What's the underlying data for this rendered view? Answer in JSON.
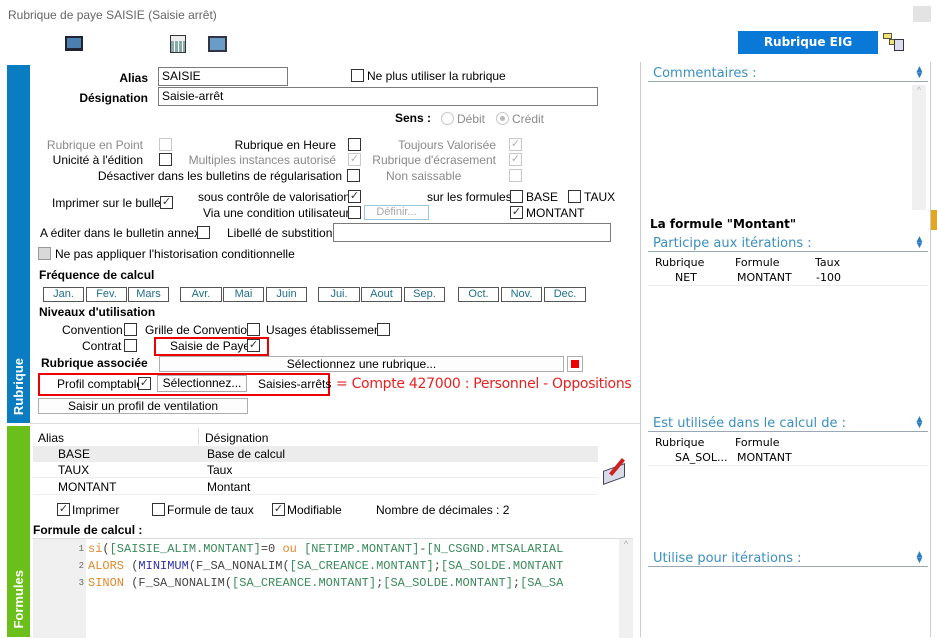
{
  "window": {
    "title": "Rubrique de paye SAISIE (Saisie arrêt)"
  },
  "toolbar": {
    "icons": [
      "monitor-icon",
      "calculator-icon",
      "window-monitor-icon"
    ],
    "eig_button": "Rubrique EIG"
  },
  "sidebar": {
    "rubrique": "Rubrique",
    "formules": "Formules",
    "rubrique_color": "#0a7cc1",
    "formules_color": "#6abf1a"
  },
  "form": {
    "alias_label": "Alias",
    "alias_value": "SAISIE",
    "designation_label": "Désignation",
    "designation_value": "Saisie-arrêt",
    "ne_plus_utiliser": {
      "label": "Ne plus utiliser la rubrique",
      "checked": false
    },
    "sens": {
      "label": "Sens :",
      "options": [
        "Débit",
        "Crédit"
      ],
      "selected": "Crédit"
    },
    "rubrique_en_point": {
      "label": "Rubrique en Point",
      "checked": false
    },
    "rubrique_en_heure": {
      "label": "Rubrique en Heure",
      "checked": false
    },
    "toujours_valorisee": {
      "label": "Toujours Valorisée",
      "checked": true
    },
    "unicite": {
      "label": "Unicité à l'édition",
      "checked": false
    },
    "multiples": {
      "label": "Multiples instances autorisé",
      "checked": true
    },
    "ecrasement": {
      "label": "Rubrique d'écrasement",
      "checked": true
    },
    "desactiver": {
      "label": "Désactiver dans les bulletins de régularisation",
      "checked": false
    },
    "non_saissable": {
      "label": "Non saissable",
      "checked": false
    },
    "imprimer_bulletin": {
      "label": "Imprimer sur le bulletin",
      "checked": true
    },
    "sous_controle": {
      "label": "sous contrôle de valorisation",
      "checked": true
    },
    "via_condition": {
      "label": "Via une condition utilisateur",
      "checked": false
    },
    "definir": "Définir...",
    "sur_formules": {
      "label": "sur les formules :",
      "base": "BASE",
      "base_checked": false,
      "taux": "TAUX",
      "taux_checked": false,
      "montant": "MONTANT",
      "montant_checked": true
    },
    "bulletin_annexe": {
      "label": "A éditer dans le bulletin annexe",
      "checked": false
    },
    "libelle_substition": {
      "label": "Libellé de substition :",
      "value": ""
    },
    "historisation": {
      "label": "Ne pas appliquer l'historisation conditionnelle",
      "checked": false
    },
    "frequence": {
      "label": "Fréquence de calcul",
      "months": [
        "Jan.",
        "Fev.",
        "Mars",
        "Avr.",
        "Mai",
        "Juin",
        "Jui.",
        "Aout",
        "Sep.",
        "Oct.",
        "Nov.",
        "Dec."
      ]
    },
    "niveaux": {
      "label": "Niveaux d'utilisation",
      "convention": "Convention",
      "grille": "Grille de Convention",
      "usages": "Usages établissement",
      "contrat": "Contrat",
      "saisie_paye": "Saisie de Paye",
      "saisie_paye_checked": true
    },
    "rubrique_associee": {
      "label": "Rubrique associée",
      "button": "Sélectionnez une rubrique..."
    },
    "profil_comptable": {
      "label": "Profil comptable",
      "checked": true,
      "button": "Sélectionnez...",
      "value": "Saisies-arrêts"
    },
    "annotation": "= Compte 427000 : Personnel - Oppositions",
    "ventilation_button": "Saisir un profil de ventilation"
  },
  "formules": {
    "columns": [
      "Alias",
      "Désignation"
    ],
    "rows": [
      {
        "alias": "BASE",
        "designation": "Base de calcul"
      },
      {
        "alias": "TAUX",
        "designation": "Taux"
      },
      {
        "alias": "MONTANT",
        "designation": "Montant"
      }
    ],
    "imprimer": {
      "label": "Imprimer",
      "checked": true
    },
    "formule_taux": {
      "label": "Formule de taux",
      "checked": false
    },
    "modifiable": {
      "label": "Modifiable",
      "checked": true
    },
    "decimales": "Nombre de décimales : 2",
    "formule_label": "Formule de calcul :",
    "code": [
      {
        "n": "1",
        "tokens": [
          [
            "kw",
            "si"
          ],
          [
            "df",
            "("
          ],
          [
            "fd",
            "[SAISIE_ALIM.MONTANT]"
          ],
          [
            "df",
            "=0 "
          ],
          [
            "kw",
            "ou"
          ],
          [
            "df",
            " "
          ],
          [
            "fd",
            "[NETIMP.MONTANT]"
          ],
          [
            "df",
            "-"
          ],
          [
            "fd",
            "[N_CSGND.MTSALARIAL"
          ]
        ]
      },
      {
        "n": "2",
        "tokens": [
          [
            "kw",
            "ALORS"
          ],
          [
            "df",
            " ("
          ],
          [
            "fn",
            "MINIMUM"
          ],
          [
            "df",
            "(F_SA_NONALIM("
          ],
          [
            "fd",
            "[SA_CREANCE.MONTANT]"
          ],
          [
            "df",
            ";"
          ],
          [
            "fd",
            "[SA_SOLDE.MONTANT"
          ]
        ]
      },
      {
        "n": "3",
        "tokens": [
          [
            "kw",
            "SINON"
          ],
          [
            "df",
            " (F_SA_NONALIM("
          ],
          [
            "fd",
            "[SA_CREANCE.MONTANT]"
          ],
          [
            "df",
            ";"
          ],
          [
            "fd",
            "[SA_SOLDE.MONTANT]"
          ],
          [
            "df",
            ";"
          ],
          [
            "fd",
            "[SA_SA"
          ]
        ]
      }
    ]
  },
  "right": {
    "commentaires": "Commentaires :",
    "formule_title": "La formule \"Montant\"",
    "participe": "Participe aux itérations :",
    "participe_cols": [
      "Rubrique",
      "Formule",
      "Taux"
    ],
    "participe_rows": [
      [
        "NET",
        "MONTANT",
        "-100"
      ]
    ],
    "utilisee": "Est utilisée dans le calcul de :",
    "utilisee_cols": [
      "Rubrique",
      "Formule"
    ],
    "utilisee_rows": [
      [
        "SA_SOL...",
        "MONTANT"
      ]
    ],
    "utilise_iter": "Utilise pour itérations :"
  }
}
